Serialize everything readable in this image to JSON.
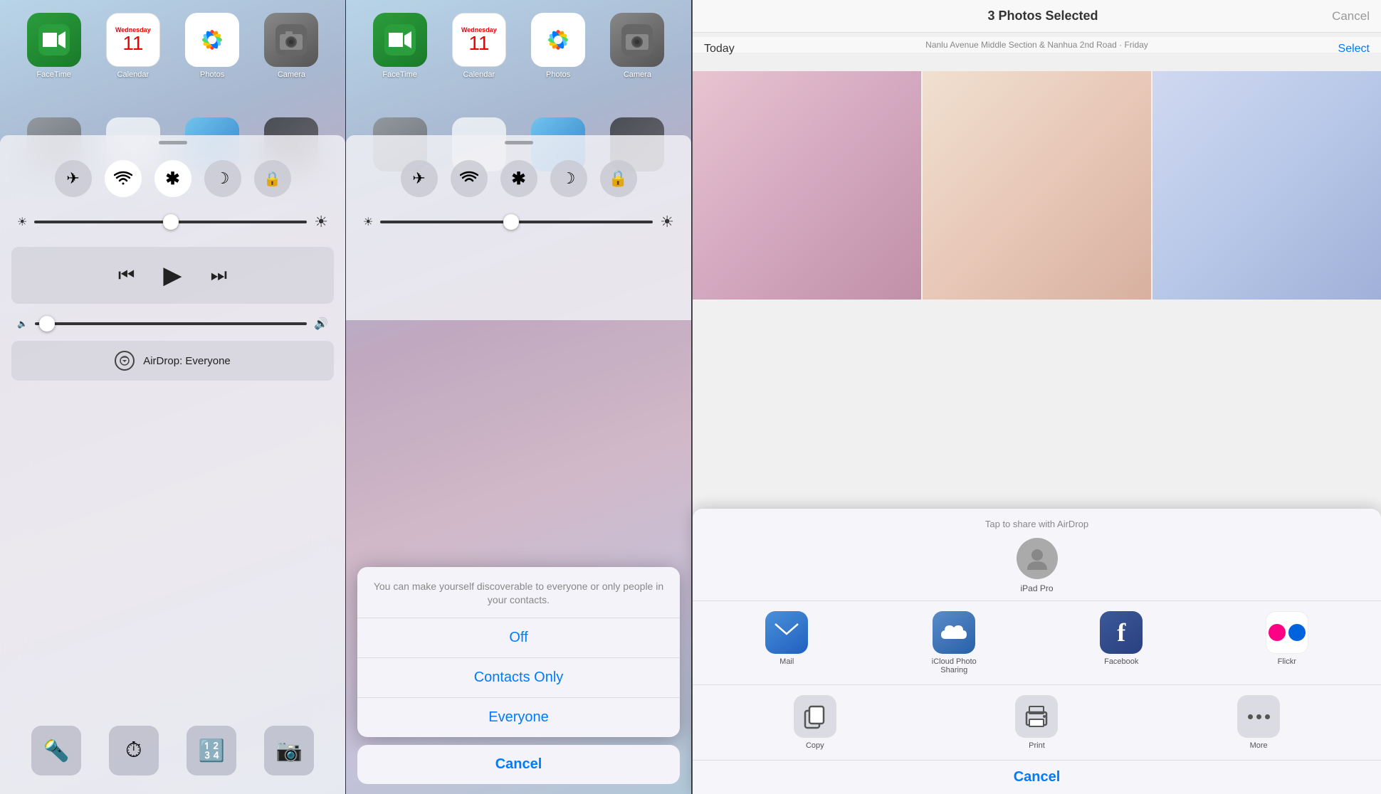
{
  "panel1": {
    "apps": [
      {
        "label": "FaceTime",
        "icon": "facetime"
      },
      {
        "label": "Calendar",
        "icon": "calendar",
        "day": "11",
        "dayLabel": "Wednesday"
      },
      {
        "label": "Photos",
        "icon": "photos"
      },
      {
        "label": "Camera",
        "icon": "camera"
      }
    ],
    "controlCenter": {
      "toggles": [
        {
          "name": "airplane",
          "symbol": "✈",
          "active": false
        },
        {
          "name": "wifi",
          "symbol": "📶",
          "active": true
        },
        {
          "name": "bluetooth",
          "symbol": "✱",
          "active": true
        },
        {
          "name": "doNotDisturb",
          "symbol": "☽",
          "active": false
        },
        {
          "name": "rotation",
          "symbol": "⟳",
          "active": false
        }
      ],
      "airdrop": "AirDrop: Everyone",
      "quickApps": [
        "🔦",
        "⏱",
        "🔢",
        "📷"
      ]
    }
  },
  "panel2": {
    "apps": [
      {
        "label": "FaceTime",
        "icon": "facetime"
      },
      {
        "label": "Calendar",
        "icon": "calendar",
        "day": "11",
        "dayLabel": "Wednesday"
      },
      {
        "label": "Photos",
        "icon": "photos"
      },
      {
        "label": "Camera",
        "icon": "camera"
      }
    ],
    "airDropSheet": {
      "message": "You can make yourself discoverable to everyone or only people in your contacts.",
      "options": [
        "Off",
        "Contacts Only",
        "Everyone"
      ],
      "cancel": "Cancel"
    }
  },
  "panel3": {
    "header": {
      "title": "3 Photos Selected",
      "cancel": "Cancel",
      "sectionLabel": "Today",
      "selectLabel": "Select",
      "subheader": "Nanlu Avenue Middle Section & Nanhua 2nd Road · Friday"
    },
    "shareSheet": {
      "airdropLabel": "Tap to share with AirDrop",
      "airdropPerson": "iPad Pro",
      "apps": [
        {
          "name": "Mail",
          "icon": "mail"
        },
        {
          "name": "iCloud Photo Sharing",
          "icon": "icloud"
        },
        {
          "name": "Facebook",
          "icon": "facebook"
        },
        {
          "name": "Flickr",
          "icon": "flickr"
        }
      ],
      "actions": [
        {
          "name": "Copy",
          "icon": "copy"
        },
        {
          "name": "Print",
          "icon": "print"
        },
        {
          "name": "More",
          "icon": "more"
        }
      ],
      "cancel": "Cancel"
    }
  }
}
